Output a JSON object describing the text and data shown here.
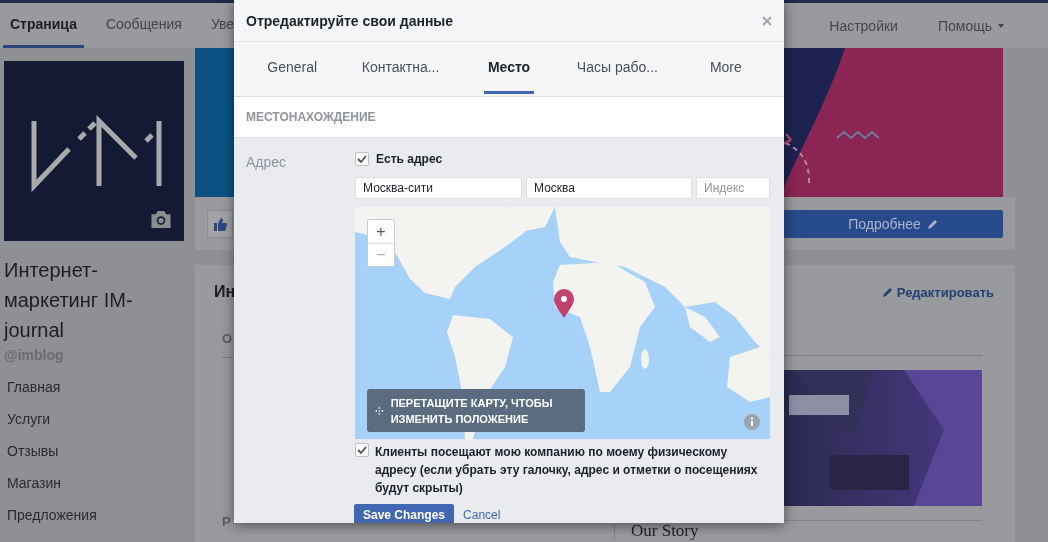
{
  "top_nav": {
    "tabs": [
      {
        "label": "Страница",
        "selected": true
      },
      {
        "label": "Сообщения",
        "selected": false
      },
      {
        "label": "Уве",
        "selected": false
      }
    ],
    "links": [
      {
        "label": "Настройки",
        "kind": "link"
      },
      {
        "label": "Помощь",
        "kind": "dropdown"
      }
    ]
  },
  "sidebar": {
    "name": "Интернет-маркетинг IM-journal",
    "handle": "@imblog",
    "items": [
      "Главная",
      "Услуги",
      "Отзывы",
      "Магазин",
      "Предложения"
    ]
  },
  "content": {
    "cover": {
      "kind": "picture"
    },
    "more_button": "Подробнее",
    "card": {
      "title": "Ин",
      "edit_link": "Редактировать",
      "row_labels": [
        "О",
        "Р"
      ],
      "banner": {
        "kind": "picture"
      },
      "story_title": "Our Story"
    }
  },
  "dialog": {
    "title": "Отредактируйте свои данные",
    "tabs": [
      {
        "label": "General",
        "selected": false
      },
      {
        "label": "Контактна...",
        "selected": false
      },
      {
        "label": "Место",
        "selected": true
      },
      {
        "label": "Часы рабо...",
        "selected": false
      },
      {
        "label": "More",
        "selected": false
      }
    ],
    "section": "МЕСТОНАХОЖДЕНИЕ",
    "address_label": "Адрес",
    "has_address": {
      "label": "Есть адрес",
      "checked": true
    },
    "fields": [
      {
        "value": "Москва-сити"
      },
      {
        "value": "Москва"
      },
      {
        "placeholder": "Индекс"
      }
    ],
    "map": {
      "zoom_in": "+",
      "zoom_out": "−",
      "hint": "ПЕРЕТАЩИТЕ КАРТУ, ЧТОБЫ ИЗМЕНИТЬ ПОЛОЖЕНИЕ"
    },
    "visits": {
      "label": "Клиенты посещают мою компанию по моему физическому адресу (если убрать эту галочку, адрес и отметки о посещениях будут скрыты)",
      "checked": true
    },
    "save": "Save Changes",
    "cancel": "Cancel"
  }
}
